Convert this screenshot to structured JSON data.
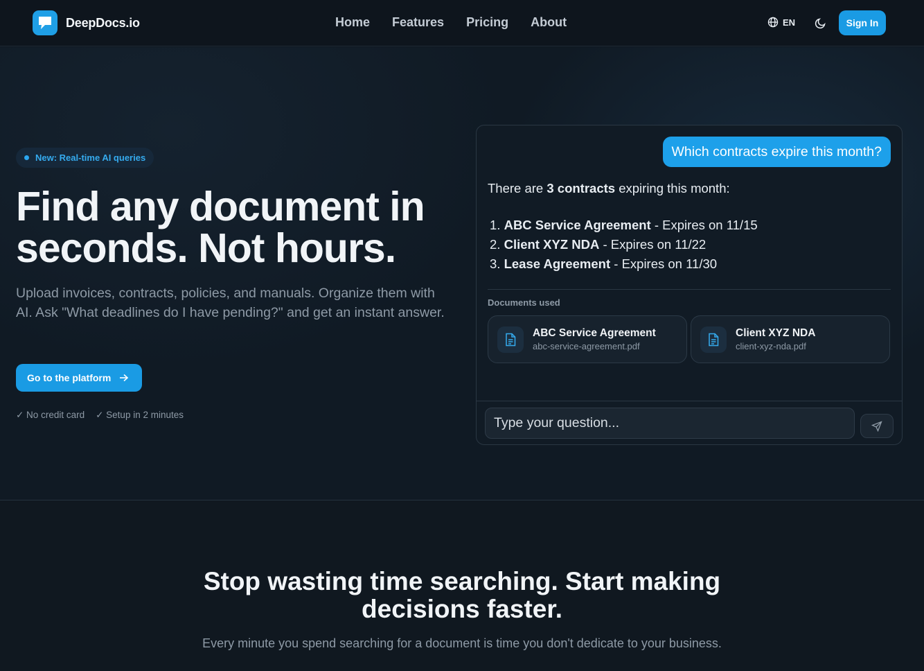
{
  "nav": {
    "brand": "DeepDocs.io",
    "links": [
      "Home",
      "Features",
      "Pricing",
      "About"
    ],
    "lang": "EN",
    "signin": "Sign In"
  },
  "hero": {
    "badge": "New: Real-time AI queries",
    "title": "Find any document in seconds. Not hours.",
    "subtitle": "Upload invoices, contracts, policies, and manuals. Organize them with AI. Ask \"What deadlines do I have pending?\" and get an instant answer.",
    "cta": "Go to the platform",
    "checks": [
      "✓ No credit card",
      "✓ Setup in 2 minutes"
    ]
  },
  "chat": {
    "user_message": "Which contracts expire this month?",
    "answer_prefix": "There are ",
    "answer_bold": "3 contracts",
    "answer_suffix": " expiring this month:",
    "items": [
      {
        "num": "1.",
        "name": "ABC Service Agreement",
        "rest": " - Expires on 11/15"
      },
      {
        "num": "2.",
        "name": "Client XYZ NDA",
        "rest": " - Expires on 11/22"
      },
      {
        "num": "3.",
        "name": "Lease Agreement",
        "rest": " - Expires on 11/30"
      }
    ],
    "docs_label": "Documents used",
    "docs": [
      {
        "title": "ABC Service Agreement",
        "file": "abc-service-agreement.pdf"
      },
      {
        "title": "Client XYZ NDA",
        "file": "client-xyz-nda.pdf"
      }
    ],
    "input_placeholder": "Type your question..."
  },
  "section2": {
    "title": "Stop wasting time searching. Start making decisions faster.",
    "text": "Every minute you spend searching for a document is time you don't dedicate to your business."
  },
  "colors": {
    "accent": "#1a9be4",
    "background": "#101a24"
  }
}
